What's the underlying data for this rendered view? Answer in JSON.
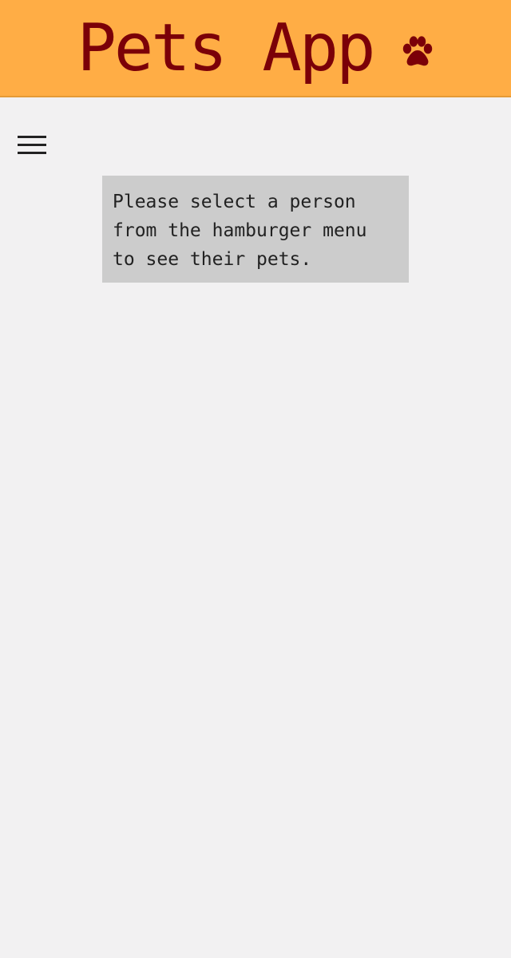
{
  "header": {
    "title": "Pets App",
    "icon": "paw-icon",
    "background": "#ffad45",
    "title_color": "#7b0008"
  },
  "navigation": {
    "menu_icon": "hamburger-menu-icon"
  },
  "main": {
    "message": "Please select a person\nfrom the hamburger menu\nto see their pets.",
    "message_background": "#cccccc"
  },
  "page": {
    "background": "#f2f1f2"
  }
}
